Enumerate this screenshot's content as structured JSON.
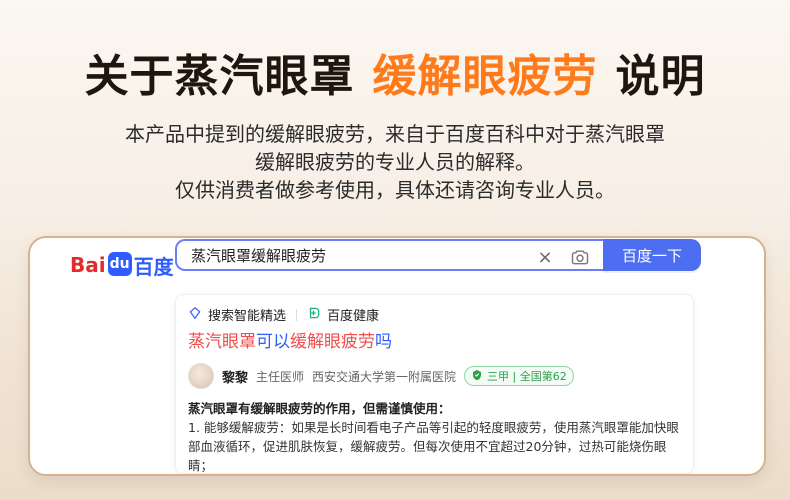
{
  "headline": {
    "part1": "关于蒸汽眼罩",
    "part2": "缓解眼疲劳",
    "part3": "说明",
    "accent_color": "#ff7a1a"
  },
  "description": {
    "line1": "本产品中提到的缓解眼疲劳，来自于百度百科中对于蒸汽眼罩",
    "line2": "缓解眼疲劳的专业人员的解释。",
    "line3": "仅供消费者做参考使用，具体还请咨询专业人员。"
  },
  "search": {
    "logo_latin": "Bai",
    "logo_paw": "du",
    "logo_cn": "百度",
    "query": "蒸汽眼罩缓解眼疲劳",
    "button_label": "百度一下",
    "icons": {
      "clear": "close-icon",
      "camera": "camera-icon"
    },
    "accent_color": "#4e6ef2"
  },
  "result": {
    "chips": {
      "left": "搜索智能精选",
      "right": "百度健康"
    },
    "title": {
      "part1": "蒸汽眼罩",
      "part2": "可以",
      "part3": "缓解眼疲劳",
      "part4": "吗"
    },
    "author": {
      "name": "黎黎",
      "role": "主任医师",
      "hospital": "西安交通大学第一附属医院",
      "badge": "三甲 | 全国第62"
    },
    "content": {
      "line1": "蒸汽眼罩有缓解眼疲劳的作用，但需谨慎使用：",
      "line2": "1. 能够缓解疲劳：如果是长时间看电子产品等引起的轻度眼疲劳，使用蒸汽眼罩能加快眼",
      "line3": "部血液循环，促进肌肤恢复，缓解疲劳。但每次使用不宜超过20分钟，过热可能烧伤眼",
      "line4": "睛；"
    }
  }
}
